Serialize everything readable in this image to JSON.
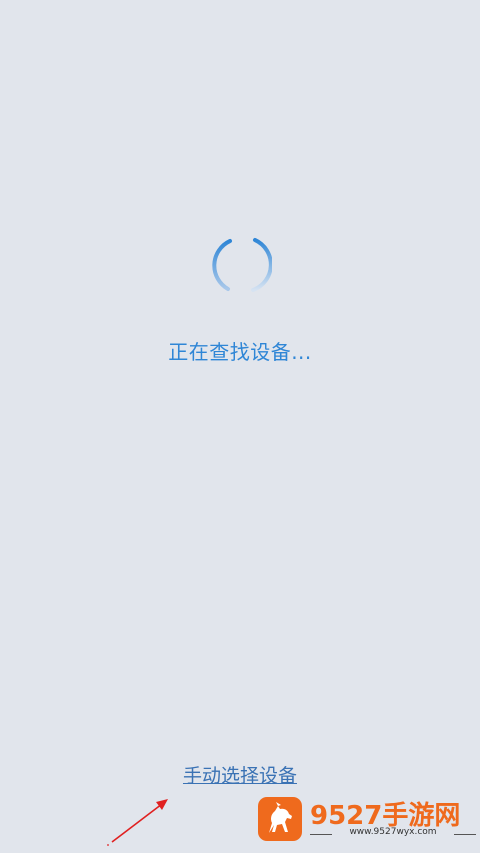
{
  "status": {
    "text": "正在查找设备..."
  },
  "actions": {
    "manual_select_label": "手动选择设备"
  },
  "watermark": {
    "title": "9527手游网",
    "url": "www.9527wyx.com"
  },
  "colors": {
    "background": "#e1e5ec",
    "accent": "#2f86d6",
    "link": "#3a72b4",
    "annotation_arrow": "#e02020",
    "watermark_orange": "#ef6a1d"
  },
  "icons": {
    "spinner": "loading-spinner-icon",
    "arrow": "red-arrow-annotation",
    "logo": "horse-logo-icon"
  }
}
